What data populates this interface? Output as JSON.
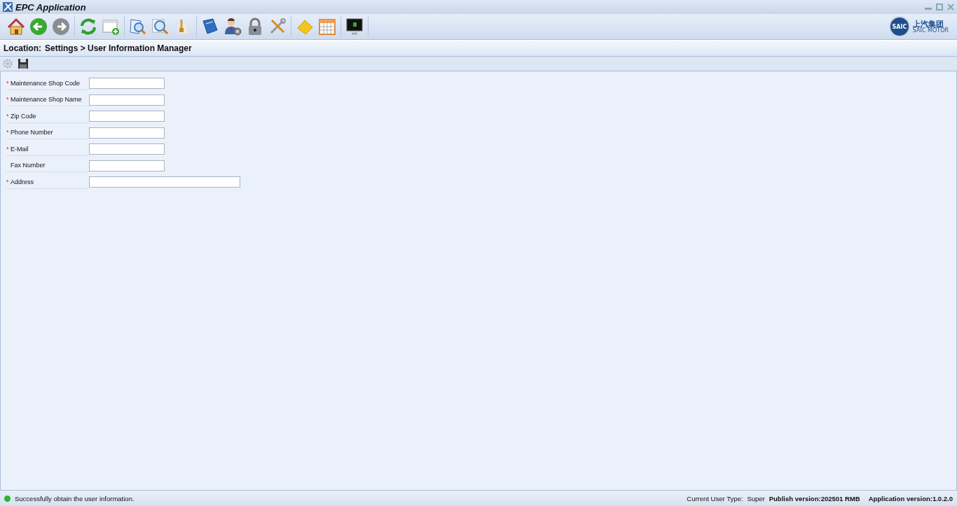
{
  "window": {
    "title": "EPC Application"
  },
  "logo": {
    "emblem": "SAIC",
    "name_cn": "上汽集团",
    "name_en": "SAIC MOTOR"
  },
  "location": {
    "label": "Location:",
    "path": "Settings > User Information Manager"
  },
  "subtoolbar": [
    {
      "kind": "settings",
      "disabled": true
    },
    {
      "kind": "save",
      "disabled": false
    }
  ],
  "form": {
    "fields": [
      {
        "label": "Maintenance Shop Code",
        "required_mark": "*",
        "kind": "short"
      },
      {
        "label": "Maintenance Shop Name",
        "required_mark": "*",
        "kind": "short"
      },
      {
        "label": "Zip Code",
        "required_mark": "*",
        "kind": "short"
      },
      {
        "label": "Phone Number",
        "required_mark": "*",
        "kind": "short"
      },
      {
        "label": "E-Mail",
        "required_mark": "*",
        "kind": "short"
      },
      {
        "label": "Fax Number",
        "kind": "short"
      },
      {
        "label": "Address",
        "required_mark": "*",
        "kind": "long"
      }
    ]
  },
  "status_bar": {
    "message": "Successfully obtain the user information.",
    "user_type_label": "Current User Type:",
    "user_type": "Super",
    "publish_version": "Publish version:202501 RMB",
    "app_version": "Application version:1.0.2.0"
  }
}
